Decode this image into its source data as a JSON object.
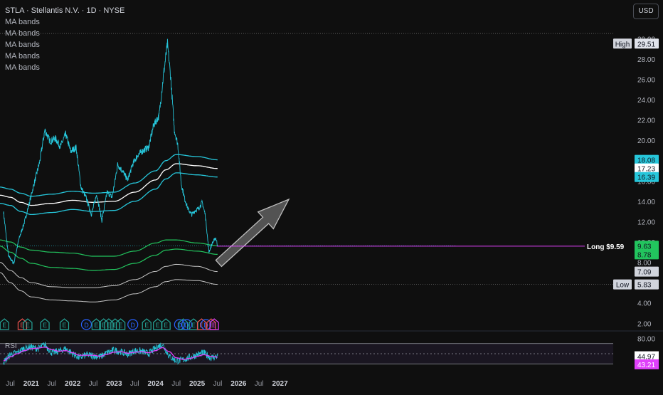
{
  "header": {
    "title": "STLA · Stellantis N.V. · 1D · NYSE",
    "indicators": [
      "MA bands",
      "MA bands",
      "MA bands",
      "MA bands",
      "MA bands"
    ]
  },
  "currency_button": "USD",
  "rsi_label": "RSI",
  "colors": {
    "price": "#26c6da",
    "upper_band": "#26c6da",
    "mid_band": "#ffffff",
    "green_band": "#22c55e",
    "gray_band": "#c8c8c8",
    "rsi": "#26c6da",
    "rsi_ma": "#e040fb",
    "long_line": "#e040fb",
    "arrow": "#8c8c8c"
  },
  "chart_data": {
    "type": "line",
    "symbol": "STLA",
    "interval": "1D",
    "x_ticks": [
      "Jul",
      "2021",
      "Jul",
      "2022",
      "Jul",
      "2023",
      "Jul",
      "2024",
      "Jul",
      "2025",
      "Jul",
      "2026",
      "Jul",
      "2027"
    ],
    "y_ticks": [
      "2.00",
      "4.00",
      "6.00",
      "8.00",
      "10.00",
      "12.00",
      "14.00",
      "16.00",
      "18.00",
      "20.00",
      "22.00",
      "24.00",
      "26.00",
      "28.00",
      "30.00"
    ],
    "ylim": [
      1.6,
      31.0
    ],
    "log_scale": false,
    "grid": false,
    "price_series": {
      "x": [
        "2020-05-01",
        "2020-06-15",
        "2020-08-01",
        "2020-09-15",
        "2020-11-01",
        "2020-12-15",
        "2021-02-01",
        "2021-03-15",
        "2021-05-01",
        "2021-06-15",
        "2021-08-01",
        "2021-09-15",
        "2021-11-01",
        "2021-12-15",
        "2022-02-01",
        "2022-03-15",
        "2022-05-01",
        "2022-06-15",
        "2022-08-01",
        "2022-09-15",
        "2022-11-01",
        "2022-12-15",
        "2023-02-01",
        "2023-03-15",
        "2023-05-01",
        "2023-06-15",
        "2023-08-01",
        "2023-09-15",
        "2023-11-01",
        "2023-12-15",
        "2024-02-01",
        "2024-03-15",
        "2024-04-15",
        "2024-05-15",
        "2024-06-15",
        "2024-07-15",
        "2024-08-15",
        "2024-09-15",
        "2024-10-15",
        "2024-11-15",
        "2024-12-15",
        "2025-01-15",
        "2025-02-15",
        "2025-03-15",
        "2025-04-15",
        "2025-05-15",
        "2025-06-15",
        "2025-07-01"
      ],
      "y": [
        13.0,
        8.6,
        7.9,
        10.3,
        11.9,
        13.8,
        16.0,
        17.8,
        21.0,
        19.9,
        20.2,
        19.4,
        20.6,
        18.9,
        19.3,
        15.4,
        14.3,
        12.7,
        14.7,
        12.1,
        14.9,
        14.4,
        17.6,
        17.0,
        16.1,
        17.7,
        18.6,
        19.0,
        19.3,
        21.5,
        22.4,
        26.8,
        29.5,
        26.0,
        21.0,
        19.6,
        15.7,
        14.2,
        13.2,
        12.7,
        13.1,
        13.3,
        13.9,
        12.6,
        9.0,
        9.9,
        10.4,
        9.63
      ]
    },
    "ma_bands": [
      {
        "name": "upper",
        "x": [
          "2020-04-01",
          "2020-07-01",
          "2020-10-01",
          "2021-01-01",
          "2021-07-01",
          "2022-01-01",
          "2022-07-01",
          "2023-01-01",
          "2023-07-01",
          "2024-01-01",
          "2024-04-01",
          "2024-07-01",
          "2025-01-01",
          "2025-06-30"
        ],
        "y": [
          15.4,
          15.2,
          14.8,
          14.5,
          14.7,
          15.0,
          14.8,
          14.9,
          15.8,
          17.0,
          18.0,
          18.6,
          18.4,
          18.08
        ]
      },
      {
        "name": "middle",
        "x": [
          "2020-04-01",
          "2020-07-01",
          "2020-10-01",
          "2021-01-01",
          "2021-07-01",
          "2022-01-01",
          "2022-07-01",
          "2023-01-01",
          "2023-07-01",
          "2024-01-01",
          "2024-04-01",
          "2024-07-01",
          "2025-01-01",
          "2025-06-30"
        ],
        "y": [
          14.6,
          14.4,
          13.9,
          13.6,
          13.8,
          14.1,
          13.9,
          14.0,
          14.9,
          16.1,
          17.1,
          17.7,
          17.5,
          17.23
        ]
      },
      {
        "name": "lower",
        "x": [
          "2020-04-01",
          "2020-07-01",
          "2020-10-01",
          "2021-01-01",
          "2021-07-01",
          "2022-01-01",
          "2022-07-01",
          "2023-01-01",
          "2023-07-01",
          "2024-01-01",
          "2024-04-01",
          "2024-07-01",
          "2025-01-01",
          "2025-06-30"
        ],
        "y": [
          13.8,
          13.6,
          13.0,
          12.7,
          12.9,
          13.2,
          13.0,
          13.1,
          14.0,
          15.2,
          16.2,
          16.8,
          16.6,
          16.39
        ]
      },
      {
        "name": "green-upper",
        "x": [
          "2020-04-01",
          "2020-07-01",
          "2020-10-01",
          "2021-01-01",
          "2021-07-01",
          "2022-01-01",
          "2022-07-01",
          "2023-01-01",
          "2023-07-01",
          "2024-01-01",
          "2024-04-01",
          "2024-07-01",
          "2025-01-01",
          "2025-06-30"
        ],
        "y": [
          10.2,
          10.0,
          9.5,
          9.2,
          9.0,
          8.9,
          8.6,
          8.6,
          9.1,
          9.9,
          10.2,
          10.2,
          9.9,
          9.63
        ]
      },
      {
        "name": "green-lower",
        "x": [
          "2020-04-01",
          "2020-07-01",
          "2020-10-01",
          "2021-01-01",
          "2021-07-01",
          "2022-01-01",
          "2022-07-01",
          "2023-01-01",
          "2023-07-01",
          "2024-01-01",
          "2024-04-01",
          "2024-07-01",
          "2025-01-01",
          "2025-06-30"
        ],
        "y": [
          9.6,
          9.0,
          8.4,
          7.9,
          7.5,
          7.4,
          7.2,
          7.3,
          7.9,
          8.7,
          9.2,
          9.3,
          9.1,
          8.78
        ]
      },
      {
        "name": "gray-upper",
        "x": [
          "2020-04-01",
          "2020-07-01",
          "2020-10-01",
          "2021-01-01",
          "2021-07-01",
          "2022-01-01",
          "2022-07-01",
          "2023-01-01",
          "2023-07-01",
          "2024-01-01",
          "2024-04-01",
          "2024-07-01",
          "2025-01-01",
          "2025-06-30"
        ],
        "y": [
          8.0,
          7.2,
          6.5,
          6.0,
          5.6,
          5.5,
          5.5,
          5.7,
          6.3,
          7.1,
          7.6,
          7.8,
          7.6,
          7.09
        ]
      },
      {
        "name": "gray-lower",
        "x": [
          "2020-04-01",
          "2020-07-01",
          "2020-10-01",
          "2021-01-01",
          "2021-07-01",
          "2022-01-01",
          "2022-07-01",
          "2023-01-01",
          "2023-07-01",
          "2024-01-01",
          "2024-04-01",
          "2024-07-01",
          "2025-01-01",
          "2025-06-30"
        ],
        "y": [
          7.0,
          6.0,
          5.2,
          4.6,
          4.3,
          4.2,
          4.1,
          4.3,
          4.9,
          5.6,
          6.1,
          6.3,
          6.2,
          5.83
        ]
      }
    ],
    "price_labels": [
      {
        "label": "High",
        "value": "29.51",
        "y": 29.51
      },
      {
        "label": "",
        "value": "18.08",
        "y": 18.08
      },
      {
        "label": "",
        "value": "17.23",
        "y": 17.23
      },
      {
        "label": "",
        "value": "16.39",
        "y": 16.39
      },
      {
        "label": "",
        "value": "9.63",
        "y": 9.63
      },
      {
        "label": "",
        "value": "8.78",
        "y": 8.78
      },
      {
        "label": "",
        "value": "7.09",
        "y": 7.09
      },
      {
        "label": "Low",
        "value": "5.83",
        "y": 5.83
      }
    ],
    "long_position": {
      "label": "Long $9.59",
      "price": 9.59,
      "x_start": "2025-06-23"
    },
    "projection_arrow": {
      "from": [
        "2025-07-10",
        7.9
      ],
      "to": [
        "2027-03-20",
        14.2
      ]
    },
    "events": [
      {
        "type": "E",
        "date": "2020-05-10",
        "color": "green"
      },
      {
        "type": "E",
        "date": "2020-10-15",
        "color": "red"
      },
      {
        "type": "E",
        "date": "2020-12-01",
        "color": "green"
      },
      {
        "type": "E",
        "date": "2021-05-01",
        "color": "green"
      },
      {
        "type": "E",
        "date": "2021-10-20",
        "color": "green"
      },
      {
        "type": "D",
        "date": "2022-05-02",
        "color": "blue"
      },
      {
        "type": "E",
        "date": "2022-07-28",
        "color": "green"
      },
      {
        "type": "E",
        "date": "2022-10-01",
        "color": "green"
      },
      {
        "type": "E",
        "date": "2022-11-15",
        "color": "green"
      },
      {
        "type": "E",
        "date": "2023-01-10",
        "color": "green"
      },
      {
        "type": "E",
        "date": "2023-02-28",
        "color": "green"
      },
      {
        "type": "D",
        "date": "2023-06-15",
        "color": "blue"
      },
      {
        "type": "E",
        "date": "2023-10-15",
        "color": "green"
      },
      {
        "type": "E",
        "date": "2024-01-20",
        "color": "green"
      },
      {
        "type": "E",
        "date": "2024-04-01",
        "color": "green"
      },
      {
        "type": "D",
        "date": "2024-07-30",
        "color": "blue"
      },
      {
        "type": "E",
        "date": "2024-09-01",
        "color": "green"
      },
      {
        "type": "D",
        "date": "2024-10-01",
        "color": "blue"
      },
      {
        "type": "E",
        "date": "2024-12-01",
        "color": "green"
      },
      {
        "type": "E",
        "date": "2025-02-10",
        "color": "red"
      },
      {
        "type": "D",
        "date": "2025-03-20",
        "color": "blue"
      },
      {
        "type": "E",
        "date": "2025-05-05",
        "color": "red"
      },
      {
        "type": "E",
        "date": "2025-06-01",
        "color": "purple"
      }
    ],
    "rsi": {
      "y_ticks": [
        "80.00"
      ],
      "ylim": [
        15,
        85
      ],
      "bands": [
        70,
        50,
        30
      ],
      "value": 44.97,
      "ma_value": 43.21,
      "x": [
        "2020-05-01",
        "2020-07-01",
        "2020-09-01",
        "2020-11-01",
        "2021-01-01",
        "2021-03-01",
        "2021-05-01",
        "2021-07-01",
        "2021-09-01",
        "2021-11-01",
        "2022-01-01",
        "2022-03-01",
        "2022-05-01",
        "2022-07-01",
        "2022-09-01",
        "2022-11-01",
        "2023-01-01",
        "2023-03-01",
        "2023-05-01",
        "2023-07-01",
        "2023-09-01",
        "2023-11-01",
        "2024-01-01",
        "2024-03-01",
        "2024-05-01",
        "2024-07-01",
        "2024-09-01",
        "2024-11-01",
        "2025-01-01",
        "2025-03-01",
        "2025-05-01",
        "2025-06-30"
      ],
      "values": [
        33,
        48,
        52,
        61,
        63,
        60,
        68,
        52,
        55,
        60,
        50,
        42,
        48,
        46,
        44,
        52,
        57,
        54,
        49,
        56,
        55,
        50,
        61,
        69,
        45,
        36,
        38,
        43,
        48,
        52,
        42,
        44.97
      ],
      "ma": [
        36,
        44,
        50,
        56,
        60,
        61,
        63,
        58,
        55,
        56,
        52,
        47,
        47,
        47,
        45,
        49,
        53,
        54,
        51,
        53,
        54,
        52,
        56,
        62,
        54,
        42,
        39,
        41,
        45,
        48,
        45,
        43.21
      ]
    }
  }
}
